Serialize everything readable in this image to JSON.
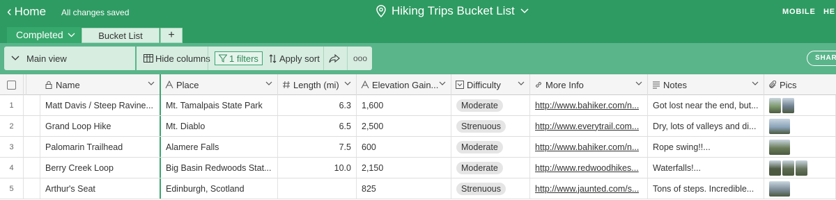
{
  "topbar": {
    "home_label": "Home",
    "save_status": "All changes saved",
    "base_name": "Hiking Trips Bucket List",
    "mobile_label": "MOBILE",
    "help_label": "HE"
  },
  "tables": {
    "active": "Completed",
    "other": "Bucket List",
    "add": "+"
  },
  "viewbar": {
    "view_name": "Main view",
    "hide_label": "Hide columns",
    "filter_label": "1 filters",
    "sort_label": "Apply sort",
    "more_label": "ooo",
    "share_label": "SHARE"
  },
  "columns": [
    {
      "label": "Name",
      "icon": "lock-icon"
    },
    {
      "label": "Place",
      "icon": "text-icon"
    },
    {
      "label": "Length (mi)",
      "icon": "number-icon"
    },
    {
      "label": "Elevation Gain...",
      "icon": "text-icon"
    },
    {
      "label": "Difficulty",
      "icon": "select-icon"
    },
    {
      "label": "More Info",
      "icon": "link-icon"
    },
    {
      "label": "Notes",
      "icon": "long-text-icon"
    },
    {
      "label": "Pics",
      "icon": "attachment-icon"
    }
  ],
  "rows": [
    {
      "n": "1",
      "name": "Matt Davis / Steep Ravine...",
      "place": "Mt. Tamalpais State Park",
      "length": "6.3",
      "elev": "1,600",
      "difficulty": "Moderate",
      "info": "http://www.bahiker.com/n...",
      "notes": "Got lost near the end, but...",
      "pics": [
        "#7f9a6e",
        "#6f7f8f"
      ]
    },
    {
      "n": "2",
      "name": "Grand Loop Hike",
      "place": "Mt. Diablo",
      "length": "6.5",
      "elev": "2,500",
      "difficulty": "Strenuous",
      "info": "http://www.everytrail.com...",
      "notes": "Dry, lots of valleys and di...",
      "pics": [
        "#8aa3b8"
      ]
    },
    {
      "n": "3",
      "name": "Palomarin Trailhead",
      "place": "Alamere Falls",
      "length": "7.5",
      "elev": "600",
      "difficulty": "Moderate",
      "info": "http://www.bahiker.com/n...",
      "notes": "Rope swing!!...",
      "pics": [
        "#6b7d5a"
      ]
    },
    {
      "n": "4",
      "name": "Berry Creek Loop",
      "place": "Big Basin Redwoods Stat...",
      "length": "10.0",
      "elev": "2,150",
      "difficulty": "Moderate",
      "info": "http://www.redwoodhikes...",
      "notes": "Waterfalls!...",
      "pics": [
        "#4e5a44",
        "#5d6b52",
        "#687560"
      ]
    },
    {
      "n": "5",
      "name": "Arthur's Seat",
      "place": "Edinburgh, Scotland",
      "length": "",
      "elev": "825",
      "difficulty": "Strenuous",
      "info": "http://www.jaunted.com/s...",
      "notes": "Tons of steps. Incredible...",
      "pics": [
        "#7d8c99"
      ]
    }
  ]
}
